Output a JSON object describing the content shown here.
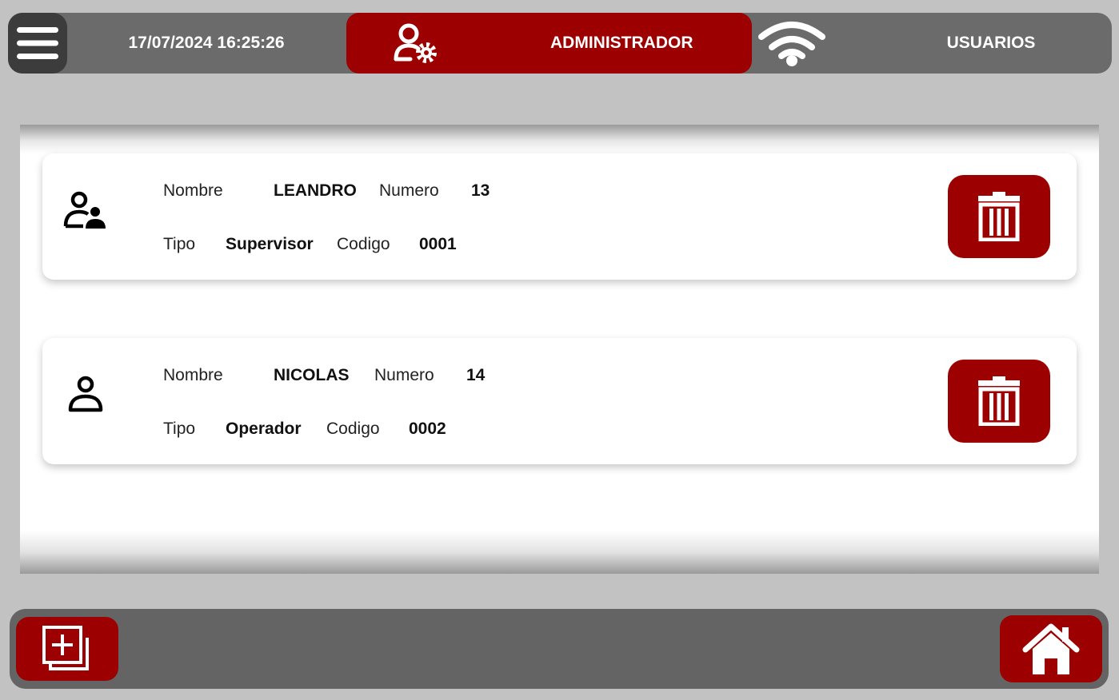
{
  "header": {
    "datetime": "17/07/2024 16:25:26",
    "role": "ADMINISTRADOR",
    "section": "USUARIOS",
    "menu_icon": "hamburger-menu-icon",
    "role_icon": "user-gear-icon",
    "wifi_icon": "wifi-icon"
  },
  "labels": {
    "name": "Nombre",
    "number": "Numero",
    "type": "Tipo",
    "code": "Codigo"
  },
  "users": [
    {
      "name": "LEANDRO",
      "number": "13",
      "type": "Supervisor",
      "code": "0001",
      "icon": "supervisor-icon"
    },
    {
      "name": "NICOLAS",
      "number": "14",
      "type": "Operador",
      "code": "0002",
      "icon": "user-icon"
    }
  ],
  "footer": {
    "add_icon": "add-copy-icon",
    "home_icon": "home-icon"
  },
  "colors": {
    "accent": "#9c0000",
    "bar": "#6b6b6b",
    "background": "#c2c2c2"
  }
}
